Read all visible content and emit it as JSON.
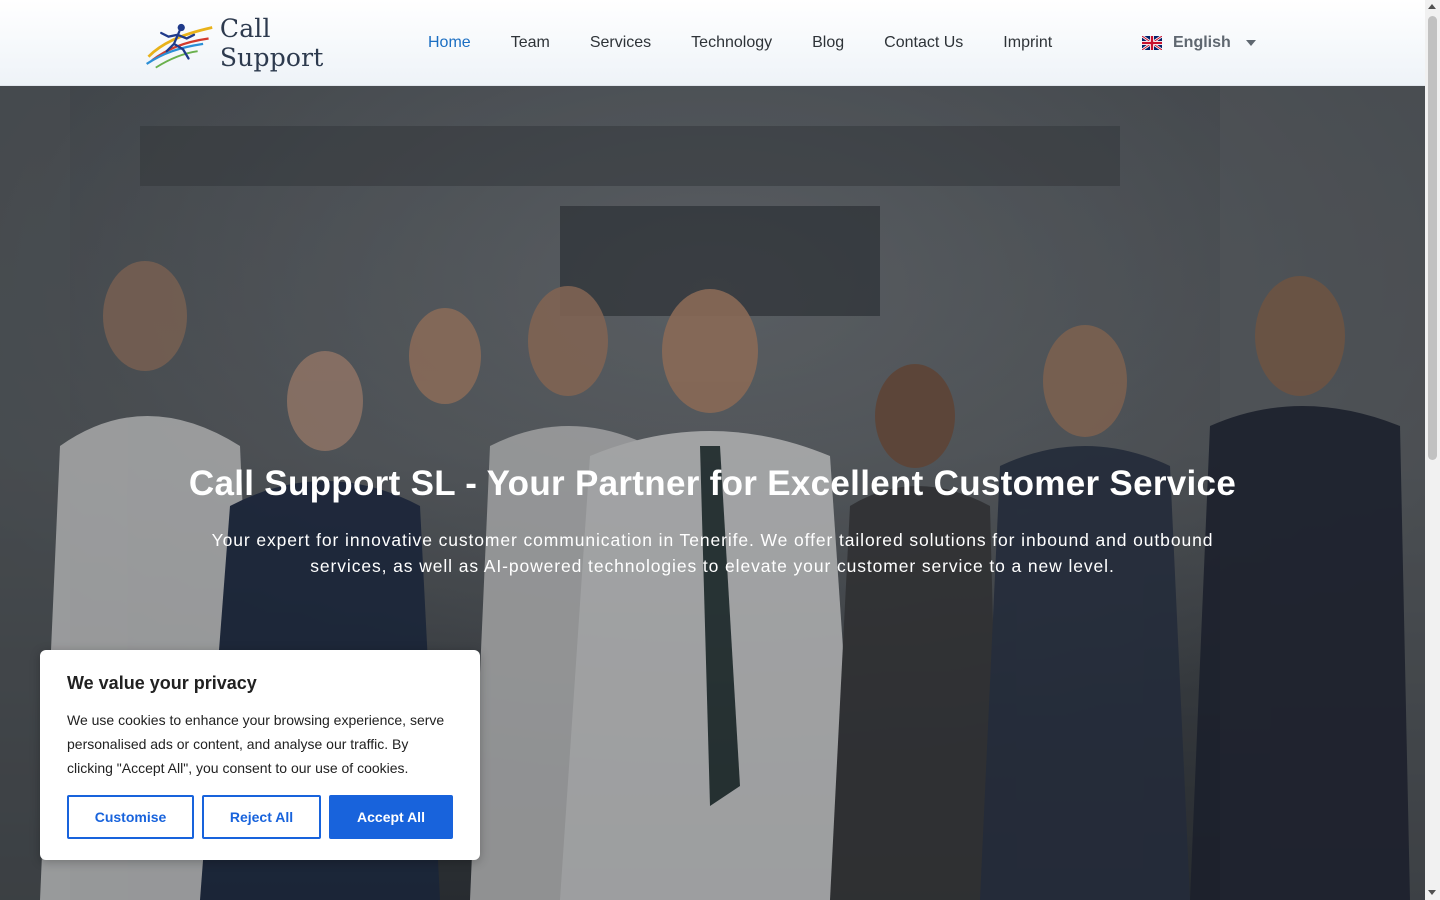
{
  "header": {
    "logo_text": "Call Support",
    "nav": [
      {
        "label": "Home",
        "active": true
      },
      {
        "label": "Team"
      },
      {
        "label": "Services"
      },
      {
        "label": "Technology"
      },
      {
        "label": "Blog"
      },
      {
        "label": "Contact Us"
      },
      {
        "label": "Imprint"
      }
    ],
    "language": {
      "label": "English",
      "flag_icon": "uk-flag-icon"
    }
  },
  "hero": {
    "title": "Call Support SL - Your Partner for Excellent Customer Service",
    "subtitle": "Your expert for innovative customer communication in Tenerife. We offer tailored solutions for inbound and outbound services, as well as AI-powered technologies to elevate your customer service to a new level."
  },
  "cookie_banner": {
    "title": "We value your privacy",
    "text": "We use cookies to enhance your browsing experience, serve personalised ads or content, and analyse our traffic. By clicking \"Accept All\", you consent to our use of cookies.",
    "buttons": {
      "customise": "Customise",
      "reject": "Reject All",
      "accept": "Accept All"
    }
  },
  "colors": {
    "accent": "#1863dc",
    "nav_active": "#1b6ec2",
    "nav_text": "#2e3338"
  }
}
